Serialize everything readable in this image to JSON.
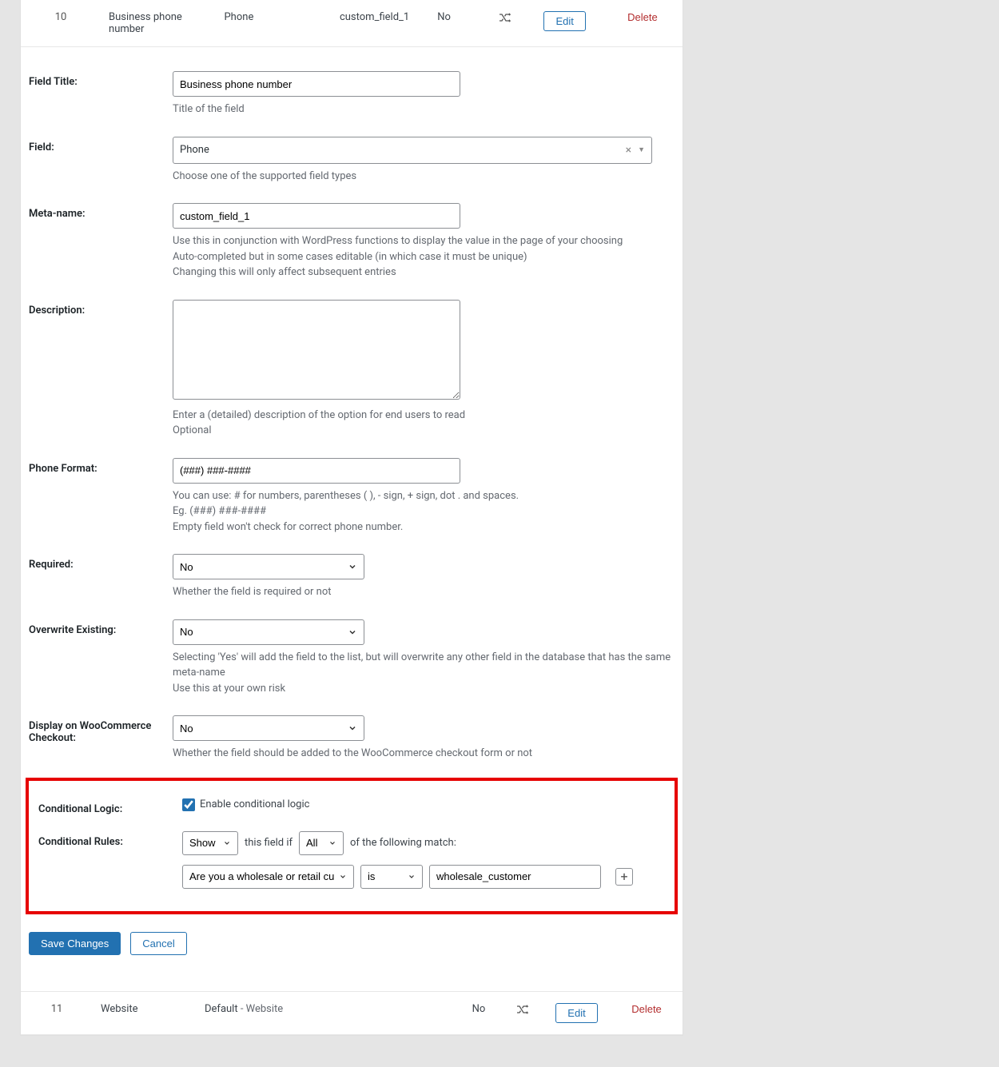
{
  "top_row": {
    "number": "10",
    "title": "Business phone number",
    "type": "Phone",
    "meta": "custom_field_1",
    "required": "No",
    "edit": "Edit",
    "delete": "Delete"
  },
  "labels": {
    "field_title": "Field Title:",
    "field": "Field:",
    "meta_name": "Meta-name:",
    "description": "Description:",
    "phone_format": "Phone Format:",
    "required": "Required:",
    "overwrite": "Overwrite Existing:",
    "woo": "Display on WooCommerce Checkout:",
    "cond_logic": "Conditional Logic:",
    "cond_rules": "Conditional Rules:"
  },
  "field_title": {
    "value": "Business phone number",
    "help": "Title of the field"
  },
  "field_type": {
    "value": "Phone",
    "help": "Choose one of the supported field types"
  },
  "meta_name": {
    "value": "custom_field_1",
    "help1": "Use this in conjunction with WordPress functions to display the value in the page of your choosing",
    "help2": "Auto-completed but in some cases editable (in which case it must be unique)",
    "help3": "Changing this will only affect subsequent entries"
  },
  "description": {
    "value": "",
    "help1": "Enter a (detailed) description of the option for end users to read",
    "help2": "Optional"
  },
  "phone_format": {
    "value": "(###) ###-####",
    "help1": "You can use: # for numbers, parentheses ( ), - sign, + sign, dot . and spaces.",
    "help2": "Eg. (###) ###-####",
    "help3": "Empty field won't check for correct phone number."
  },
  "required": {
    "value": "No",
    "help": "Whether the field is required or not"
  },
  "overwrite": {
    "value": "No",
    "help1": "Selecting 'Yes' will add the field to the list, but will overwrite any other field in the database that has the same meta-name",
    "help2": "Use this at your own risk"
  },
  "woo": {
    "value": "No",
    "help": "Whether the field should be added to the WooCommerce checkout form or not"
  },
  "cond_logic": {
    "checkbox_label": "Enable conditional logic"
  },
  "cond_rules": {
    "action": "Show",
    "mid_text": "this field if",
    "match": "All",
    "tail_text": "of the following match:",
    "field": "Are you a wholesale or retail cu",
    "operator": "is",
    "value": "wholesale_customer"
  },
  "buttons": {
    "save": "Save Changes",
    "cancel": "Cancel"
  },
  "bottom_row": {
    "number": "11",
    "title": "Website",
    "type_prefix": "Default",
    "type_sep": " - ",
    "type_value": "Website",
    "required": "No",
    "edit": "Edit",
    "delete": "Delete"
  }
}
